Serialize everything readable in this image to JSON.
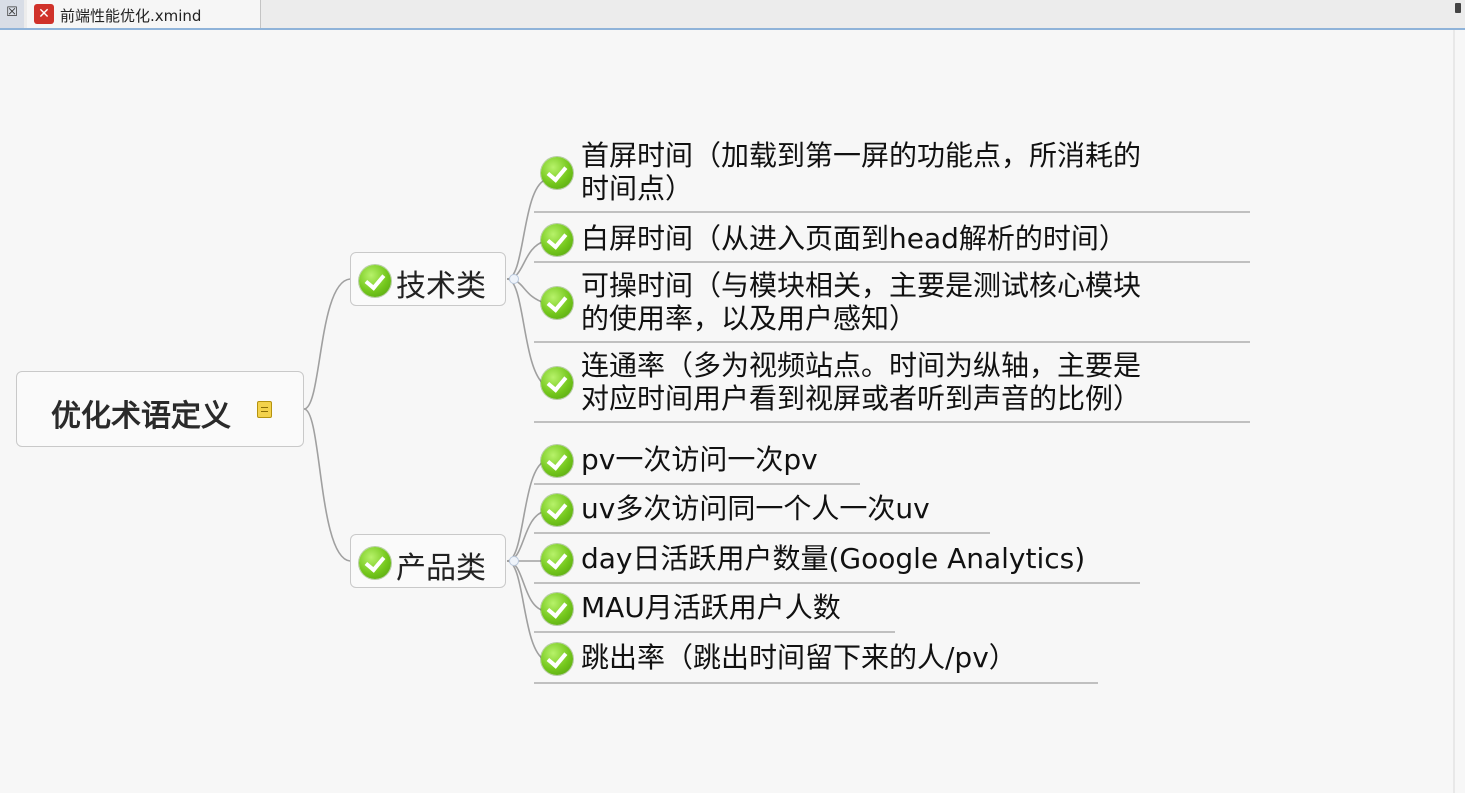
{
  "window": {
    "tab_close_glyph": "☒",
    "tab_title": "前端性能优化.xmind",
    "app_icon_glyph": "✕",
    "app_icon_name": "xmind-app-icon",
    "accent_color": "#8fb3d9"
  },
  "mindmap": {
    "central": {
      "label": "优化术语定义",
      "icon": "note-icon"
    },
    "branches": [
      {
        "label": "技术类",
        "icon": "check-circle-icon",
        "children": [
          {
            "lines": [
              "首屏时间（加载到第一屏的功能点，所消耗的",
              "时间点）"
            ]
          },
          {
            "lines": [
              "白屏时间（从进入页面到head解析的时间）"
            ]
          },
          {
            "lines": [
              "可操时间（与模块相关，主要是测试核心模块",
              "的使用率，以及用户感知）"
            ]
          },
          {
            "lines": [
              "连通率（多为视频站点。时间为纵轴，主要是",
              "对应时间用户看到视屏或者听到声音的比例）"
            ]
          }
        ]
      },
      {
        "label": "产品类",
        "icon": "check-circle-icon",
        "children": [
          {
            "lines": [
              "pv一次访问一次pv"
            ]
          },
          {
            "lines": [
              "uv多次访问同一个人一次uv"
            ]
          },
          {
            "lines": [
              "day日活跃用户数量(Google Analytics)"
            ]
          },
          {
            "lines": [
              "MAU月活跃用户人数"
            ]
          },
          {
            "lines": [
              "跳出率（跳出时间留下来的人/pv）"
            ]
          }
        ]
      }
    ]
  },
  "colors": {
    "check_green": "#74c71c",
    "note_yellow": "#f3d24c",
    "connector_gray": "#a0a0a0"
  }
}
